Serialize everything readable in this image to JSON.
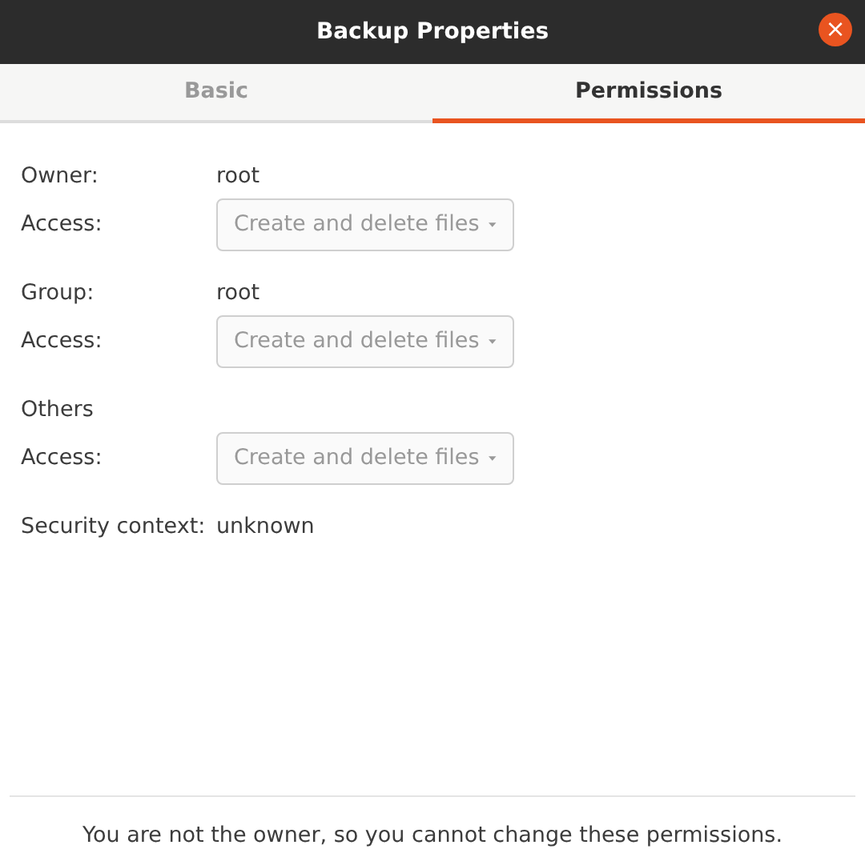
{
  "window": {
    "title": "Backup Properties",
    "close": "×"
  },
  "tabs": [
    {
      "label": "Basic",
      "selected": false
    },
    {
      "label": "Permissions",
      "selected": true
    }
  ],
  "rows": [
    {
      "kind": "label",
      "label": "Owner:",
      "value": "root"
    },
    {
      "kind": "access",
      "label": "Access:",
      "value": "Create and delete files",
      "disabled": true
    },
    {
      "kind": "label",
      "label": "Group:",
      "value": "root"
    },
    {
      "kind": "access",
      "label": "Access:",
      "value": "Create and delete files",
      "disabled": true
    },
    {
      "kind": "label",
      "label": "Others"
    },
    {
      "kind": "access",
      "label": "Access:",
      "value": "Create and delete files",
      "disabled": true
    },
    {
      "kind": "label",
      "label": "Security context:",
      "value": "unknown"
    }
  ],
  "message": "You are not the owner, so you cannot change these permissions."
}
